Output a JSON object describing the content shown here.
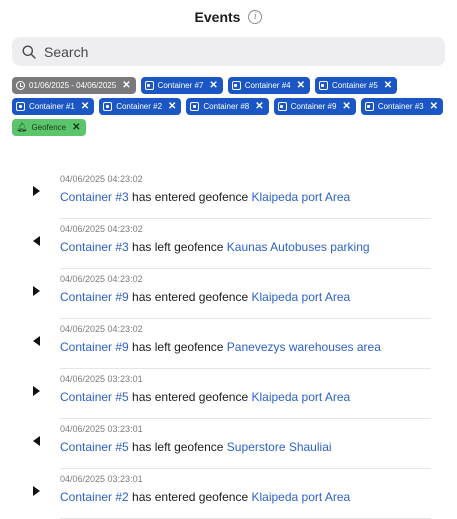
{
  "header": {
    "title": "Events",
    "info_icon": "info-icon"
  },
  "search": {
    "placeholder": "Search",
    "value": ""
  },
  "filters": {
    "date_range": "01/06/2025 - 04/06/2025",
    "containers": [
      "Container #7",
      "Container #4",
      "Container #5",
      "Container #1",
      "Container #2",
      "Container #8",
      "Container #9",
      "Container #3"
    ],
    "geofence": "Geofence"
  },
  "events": [
    {
      "timestamp": "04/06/2025 04:23:02",
      "direction": "in",
      "container": "Container #3",
      "action": " has entered geofence ",
      "place": "Klaipeda port Area"
    },
    {
      "timestamp": "04/06/2025 04:23:02",
      "direction": "out",
      "container": "Container #3",
      "action": " has left geofence ",
      "place": "Kaunas Autobuses parking"
    },
    {
      "timestamp": "04/06/2025 04:23:02",
      "direction": "in",
      "container": "Container #9",
      "action": " has entered geofence ",
      "place": "Klaipeda port Area"
    },
    {
      "timestamp": "04/06/2025 04:23:02",
      "direction": "out",
      "container": "Container #9",
      "action": " has left geofence ",
      "place": "Panevezys warehouses area"
    },
    {
      "timestamp": "04/06/2025 03:23:01",
      "direction": "in",
      "container": "Container #5",
      "action": " has entered geofence ",
      "place": "Klaipeda port Area"
    },
    {
      "timestamp": "04/06/2025 03:23:01",
      "direction": "out",
      "container": "Container #5",
      "action": " has left geofence ",
      "place": "Superstore Shauliai"
    },
    {
      "timestamp": "04/06/2025 03:23:01",
      "direction": "in",
      "container": "Container #2",
      "action": " has entered geofence ",
      "place": "Klaipeda port Area"
    }
  ],
  "colors": {
    "chip_container": "#1a56c4",
    "chip_date": "#7a7a7c",
    "chip_geofence": "#5cc46a",
    "link": "#2d62c9"
  }
}
